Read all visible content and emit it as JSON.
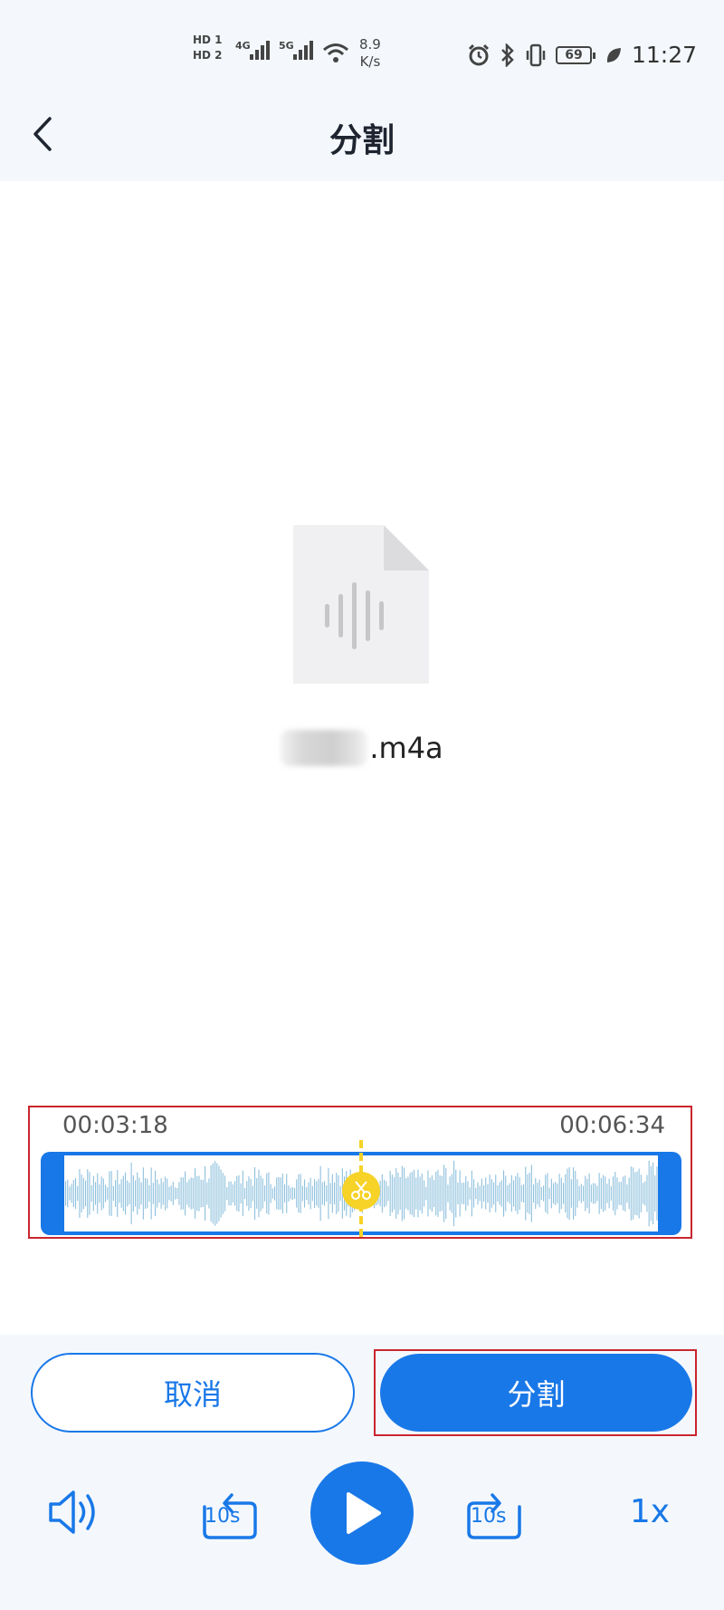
{
  "status_bar": {
    "hd1": "HD 1",
    "hd2": "HD 2",
    "net1": "4G",
    "net2": "5G",
    "speed_value": "8.9",
    "speed_unit": "K/s",
    "battery": "69",
    "time": "11:27"
  },
  "nav": {
    "title": "分割",
    "back_icon": "chevron-left-icon"
  },
  "file": {
    "extension": ".m4a",
    "icon": "audio-file-icon"
  },
  "trim": {
    "start_time": "00:03:18",
    "end_time": "00:06:34",
    "split_position": 0.5,
    "wave_color": "#8ec0dd",
    "frame_color": "#1978e8",
    "split_color": "#f7d227"
  },
  "actions": {
    "cancel_label": "取消",
    "split_label": "分割"
  },
  "player": {
    "rewind_label": "10s",
    "forward_label": "10s",
    "speed_label": "1x"
  },
  "colors": {
    "accent": "#1978e8",
    "highlight_border": "#c9262e",
    "panel_bg": "#f4f8fc"
  }
}
